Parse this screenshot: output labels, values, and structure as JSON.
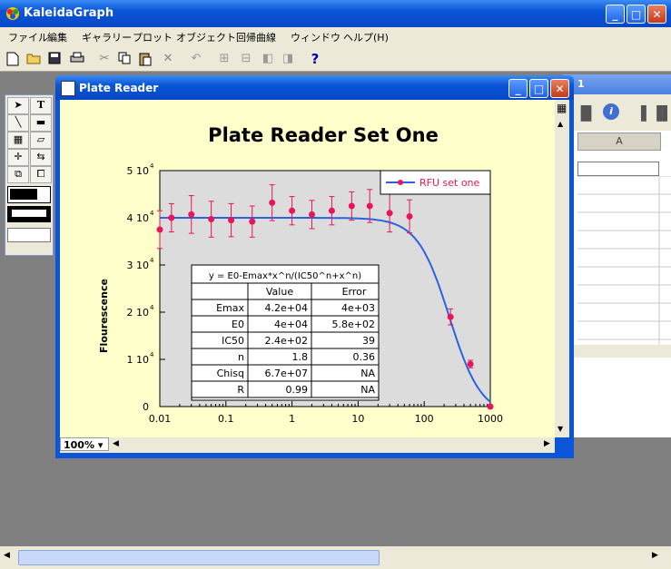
{
  "app": {
    "title": "KaleidaGraph"
  },
  "menu": [
    "ファイル",
    "編集",
    "ギャラリー",
    "プロット",
    "オブジェクト",
    "回帰曲線",
    "ウィンドウ",
    "ヘルプ(H)"
  ],
  "plot_window": {
    "title": "Plate Reader",
    "zoom": "100%"
  },
  "data_window": {
    "title_fragment": "1",
    "column": "A"
  },
  "help_icon": "?",
  "chart_data": {
    "type": "scatter",
    "title": "Plate Reader Set One",
    "xlabel": "",
    "ylabel": "Flourescence",
    "xscale": "log",
    "xlim": [
      0.01,
      1000
    ],
    "ylim": [
      0,
      50000
    ],
    "x_ticks": [
      "0.01",
      "0.1",
      "1",
      "10",
      "100",
      "1000"
    ],
    "y_ticks": [
      "0",
      "1 10",
      "2 10",
      "3 10",
      "4 10",
      "5 10"
    ],
    "y_tick_exp": "4",
    "legend": {
      "label": "RFU set one",
      "position": "top-right"
    },
    "series": [
      {
        "name": "RFU set one",
        "color": "#e8155a",
        "line_color": "#2a62e0",
        "x": [
          0.01,
          0.015,
          0.03,
          0.06,
          0.12,
          0.25,
          0.5,
          1,
          2,
          4,
          8,
          15,
          30,
          60,
          250,
          500,
          1000
        ],
        "y": [
          37500,
          40000,
          40700,
          39700,
          39500,
          39200,
          43200,
          41500,
          40700,
          41500,
          42500,
          42500,
          41000,
          40300,
          19000,
          9000,
          0
        ],
        "err": [
          4000,
          3000,
          4000,
          3800,
          3500,
          3300,
          3800,
          3000,
          3000,
          3000,
          3000,
          3500,
          4000,
          3500,
          1700,
          800,
          300
        ]
      }
    ],
    "fit": {
      "Emax": 42000,
      "E0": 40000,
      "IC50": 240,
      "n": 1.8
    },
    "table": {
      "equation": "y = E0-Emax*x^n/(IC50^n+x^n)",
      "headers": [
        "",
        "Value",
        "Error"
      ],
      "rows": [
        [
          "Emax",
          "4.2e+04",
          "4e+03"
        ],
        [
          "E0",
          "4e+04",
          "5.8e+02"
        ],
        [
          "IC50",
          "2.4e+02",
          "39"
        ],
        [
          "n",
          "1.8",
          "0.36"
        ],
        [
          "Chisq",
          "6.7e+07",
          "NA"
        ],
        [
          "R",
          "0.99",
          "NA"
        ]
      ]
    }
  }
}
